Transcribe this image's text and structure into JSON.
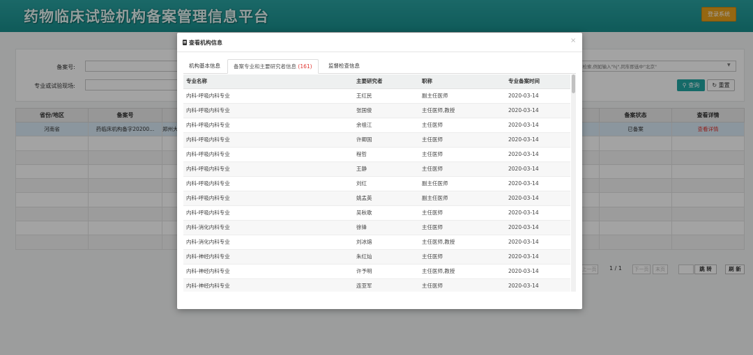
{
  "header": {
    "site_title": "药物临床试验机构备案管理信息平台",
    "login_label": "登录系统"
  },
  "search": {
    "record_no_label": "备案号:",
    "specialty_label": "专业或试验现场:",
    "location_hint": "要检索,例如输入\"hj\",同车即选中\"北京\"",
    "query_label": "查询",
    "reset_label": "重置"
  },
  "bg_table": {
    "headers": {
      "province": "省份/地区",
      "record_no": "备案号",
      "status": "备案状态",
      "detail": "查看详情"
    },
    "row": {
      "province": "河南省",
      "record_no": "药临床机构备字20200...",
      "name": "郑州大",
      "status": "已备案",
      "detail": "查看详情"
    }
  },
  "pagination": {
    "prev": "上一页",
    "page_info": "1 / 1",
    "next": "下一页",
    "last": "末页",
    "jump": "跳 转",
    "refresh": "刷 新"
  },
  "modal": {
    "title": "查看机构信息",
    "close": "×",
    "tabs": [
      {
        "label": "机构基本信息"
      },
      {
        "label": "备案专业和主要研究者信息",
        "count": "(161)"
      },
      {
        "label": "监督检查信息"
      }
    ],
    "columns": {
      "specialty": "专业名称",
      "investigator": "主要研究者",
      "title": "职称",
      "date": "专业备案时间"
    },
    "rows": [
      {
        "specialty": "内科-呼吸内科专业",
        "investigator": "王红民",
        "title": "副主任医师",
        "date": "2020-03-14"
      },
      {
        "specialty": "内科-呼吸内科专业",
        "investigator": "张国俊",
        "title": "主任医师,教授",
        "date": "2020-03-14"
      },
      {
        "specialty": "内科-呼吸内科专业",
        "investigator": "余祖江",
        "title": "主任医师",
        "date": "2020-03-14"
      },
      {
        "specialty": "内科-呼吸内科专业",
        "investigator": "许卿国",
        "title": "主任医师",
        "date": "2020-03-14"
      },
      {
        "specialty": "内科-呼吸内科专业",
        "investigator": "程哲",
        "title": "主任医师",
        "date": "2020-03-14"
      },
      {
        "specialty": "内科-呼吸内科专业",
        "investigator": "王静",
        "title": "主任医师",
        "date": "2020-03-14"
      },
      {
        "specialty": "内科-呼吸内科专业",
        "investigator": "刘红",
        "title": "副主任医师",
        "date": "2020-03-14"
      },
      {
        "specialty": "内科-呼吸内科专业",
        "investigator": "姚孟英",
        "title": "副主任医师",
        "date": "2020-03-14"
      },
      {
        "specialty": "内科-呼吸内科专业",
        "investigator": "吴秋歌",
        "title": "主任医师",
        "date": "2020-03-14"
      },
      {
        "specialty": "内科-消化内科专业",
        "investigator": "徐锋",
        "title": "主任医师",
        "date": "2020-03-14"
      },
      {
        "specialty": "内科-消化内科专业",
        "investigator": "刘冰熔",
        "title": "主任医师,教授",
        "date": "2020-03-14"
      },
      {
        "specialty": "内科-神经内科专业",
        "investigator": "朱红灿",
        "title": "主任医师",
        "date": "2020-03-14"
      },
      {
        "specialty": "内科-神经内科专业",
        "investigator": "许予明",
        "title": "主任医师,教授",
        "date": "2020-03-14"
      },
      {
        "specialty": "内科-神经内科专业",
        "investigator": "连亚军",
        "title": "主任医师",
        "date": "2020-03-14"
      }
    ]
  }
}
